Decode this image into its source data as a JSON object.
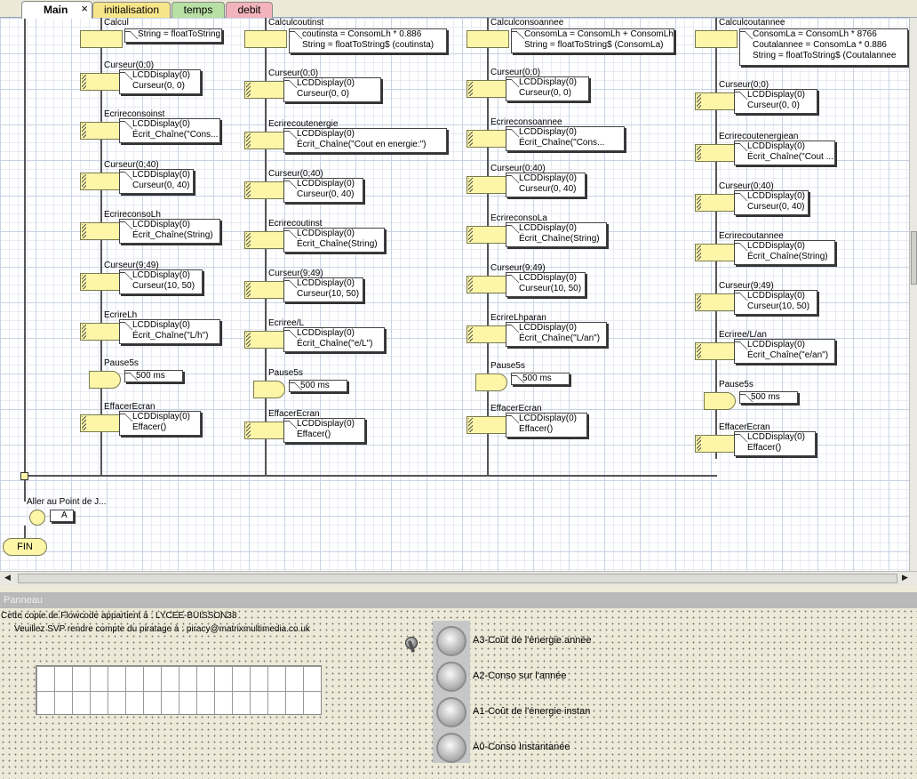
{
  "tabs": {
    "main": "Main",
    "close": "×",
    "initialisation": "initialisation",
    "temps": "temps",
    "debit": "debit"
  },
  "colors": {
    "block": "#fdf6a8",
    "tab_init": "#f7e58a",
    "tab_temps": "#b8dfa4",
    "tab_debit": "#f2b3bd"
  },
  "columns": [
    {
      "calc_title": "Calcul",
      "calc_lines": [
        "String = floatToString..."
      ],
      "blocks": [
        {
          "title": "Curseur(0;0)",
          "lines": [
            "LCDDisplay(0)",
            "Curseur(0, 0)"
          ]
        },
        {
          "title": "Ecrireconsoinst",
          "lines": [
            "LCDDisplay(0)",
            "Écrit_Chaîne(\"Cons..."
          ]
        },
        {
          "title": "Curseur(0;40)",
          "lines": [
            "LCDDisplay(0)",
            "Curseur(0, 40)"
          ]
        },
        {
          "title": "EcrireconsoLh",
          "lines": [
            "LCDDisplay(0)",
            "Écrit_Chaîne(String)"
          ]
        },
        {
          "title": "Curseur(9;49)",
          "lines": [
            "LCDDisplay(0)",
            "Curseur(10, 50)"
          ]
        },
        {
          "title": "EcrireLh",
          "lines": [
            "LCDDisplay(0)",
            "Écrit_Chaîne(\"L/h\")"
          ]
        }
      ],
      "pause_title": "Pause5s",
      "pause_value": "500 ms",
      "clear_title": "EffacerEcran",
      "clear_lines": [
        "LCDDisplay(0)",
        "Effacer()"
      ]
    },
    {
      "calc_title": "Calculcoutinst",
      "calc_lines": [
        "coutinsta = ConsomLh * 0.886",
        "String = floatToString$ (coutinsta)"
      ],
      "blocks": [
        {
          "title": "Curseur(0;0)",
          "lines": [
            "LCDDisplay(0)",
            "Curseur(0, 0)"
          ]
        },
        {
          "title": "Ecrirecoutenergie",
          "lines": [
            "LCDDisplay(0)",
            "Écrit_Chaîne(\"Cout en energie:\")"
          ]
        },
        {
          "title": "Curseur(0;40)",
          "lines": [
            "LCDDisplay(0)",
            "Curseur(0, 40)"
          ]
        },
        {
          "title": "Ecrirecoutinst",
          "lines": [
            "LCDDisplay(0)",
            "Écrit_Chaîne(String)"
          ]
        },
        {
          "title": "Curseur(9;49)",
          "lines": [
            "LCDDisplay(0)",
            "Curseur(10, 50)"
          ]
        },
        {
          "title": "Ecriree/L",
          "lines": [
            "LCDDisplay(0)",
            "Écrit_Chaîne(\"e/L\")"
          ]
        }
      ],
      "pause_title": "Pause5s",
      "pause_value": "500 ms",
      "clear_title": "EffacerEcran",
      "clear_lines": [
        "LCDDisplay(0)",
        "Effacer()"
      ]
    },
    {
      "calc_title": "Calculconsoannee",
      "calc_lines": [
        "ConsomLa = ConsomLh + ConsomLh",
        "String = floatToString$ (ConsomLa)"
      ],
      "blocks": [
        {
          "title": "Curseur(0;0)",
          "lines": [
            "LCDDisplay(0)",
            "Curseur(0, 0)"
          ]
        },
        {
          "title": "Ecrireconsoannee",
          "lines": [
            "LCDDisplay(0)",
            "Écrit_Chaîne(\"Cons..."
          ]
        },
        {
          "title": "Curseur(0;40)",
          "lines": [
            "LCDDisplay(0)",
            "Curseur(0, 40)"
          ]
        },
        {
          "title": "EcrireconsoLa",
          "lines": [
            "LCDDisplay(0)",
            "Écrit_Chaîne(String)"
          ]
        },
        {
          "title": "Curseur(9;49)",
          "lines": [
            "LCDDisplay(0)",
            "Curseur(10, 50)"
          ]
        },
        {
          "title": "EcrireLhparan",
          "lines": [
            "LCDDisplay(0)",
            "Écrit_Chaîne(\"L/an\")"
          ]
        }
      ],
      "pause_title": "Pause5s",
      "pause_value": "500 ms",
      "clear_title": "EffacerEcran",
      "clear_lines": [
        "LCDDisplay(0)",
        "Effacer()"
      ]
    },
    {
      "calc_title": "Calculcoutannee",
      "calc_lines": [
        "ConsomLa = ConsomLh * 8766",
        "Coutalannee = ConsomLa * 0.886",
        "String = floatToString$ (Coutalannee"
      ],
      "blocks": [
        {
          "title": "Curseur(0;0)",
          "lines": [
            "LCDDisplay(0)",
            "Curseur(0, 0)"
          ]
        },
        {
          "title": "Ecrirecoutenergiean",
          "lines": [
            "LCDDisplay(0)",
            "Écrit_Chaîne(\"Cout ..."
          ]
        },
        {
          "title": "Curseur(0;40)",
          "lines": [
            "LCDDisplay(0)",
            "Curseur(0, 40)"
          ]
        },
        {
          "title": "Ecrirecoutannee",
          "lines": [
            "LCDDisplay(0)",
            "Écrit_Chaîne(String)"
          ]
        },
        {
          "title": "Curseur(9;49)",
          "lines": [
            "LCDDisplay(0)",
            "Curseur(10, 50)"
          ]
        },
        {
          "title": "Ecriree/L/an",
          "lines": [
            "LCDDisplay(0)",
            "Écrit_Chaîne(\"e/an\")"
          ]
        }
      ],
      "pause_title": "Pause5s",
      "pause_value": "500 ms",
      "clear_title": "EffacerEcran",
      "clear_lines": [
        "LCDDisplay(0)",
        "Effacer()"
      ]
    }
  ],
  "goto": {
    "title": "Aller au Point de J...",
    "label": "A"
  },
  "end": {
    "label": "FIN"
  },
  "panel": {
    "title": "Panneau",
    "copyright": "Cette copie de Flowcode appartient à : LYCEE-BUISSON38",
    "piracy": "Veuillez SVP rendre compte du piratage à : piracy@matrixmultimedia.co.uk",
    "buttons": [
      "A3-Coût de l'énergie année",
      "A2-Conso sur l'année",
      "A1-Coût de l'énergie instan",
      "A0-Conso Instantanée"
    ]
  }
}
